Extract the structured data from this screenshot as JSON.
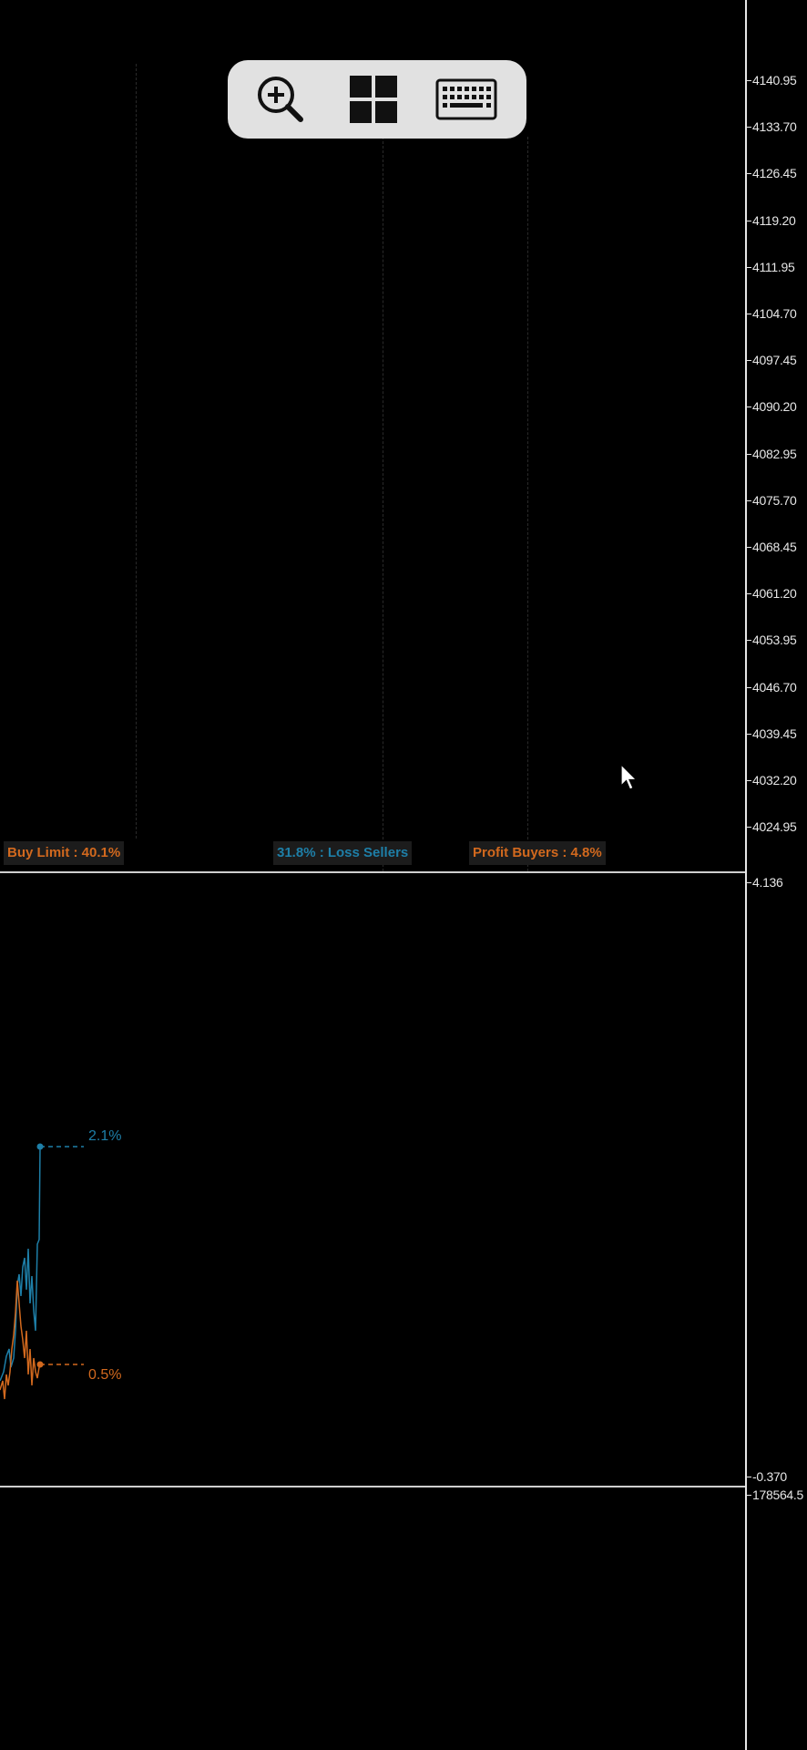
{
  "price_axis": {
    "main_ticks": [
      "4140.95",
      "4133.70",
      "4126.45",
      "4119.20",
      "4111.95",
      "4104.70",
      "4097.45",
      "4090.20",
      "4082.95",
      "4075.70",
      "4068.45",
      "4061.20",
      "4053.95",
      "4046.70",
      "4039.45",
      "4032.20",
      "4024.95"
    ],
    "indicator_max": "4.136",
    "indicator_min": "-0.370",
    "bottom_top": "178564.5"
  },
  "levels": {
    "buy_limit": "Buy Limit : 40.1%",
    "loss_sellers": "31.8% : Loss Sellers",
    "profit_buyers": "Profit Buyers : 4.8%"
  },
  "indicator": {
    "blue_value": "2.1%",
    "orange_value": "0.5%"
  },
  "toolbar": {
    "zoom": "zoom-in-icon",
    "layout": "grid-layout-icon",
    "keyboard": "keyboard-icon"
  },
  "colors": {
    "background": "#000000",
    "axis_text": "#e6e6e6",
    "orange": "#d2691e",
    "blue": "#1e7fa8",
    "label_bg": "#1c1c1c",
    "toolbar_bg": "#e1e1e1"
  }
}
